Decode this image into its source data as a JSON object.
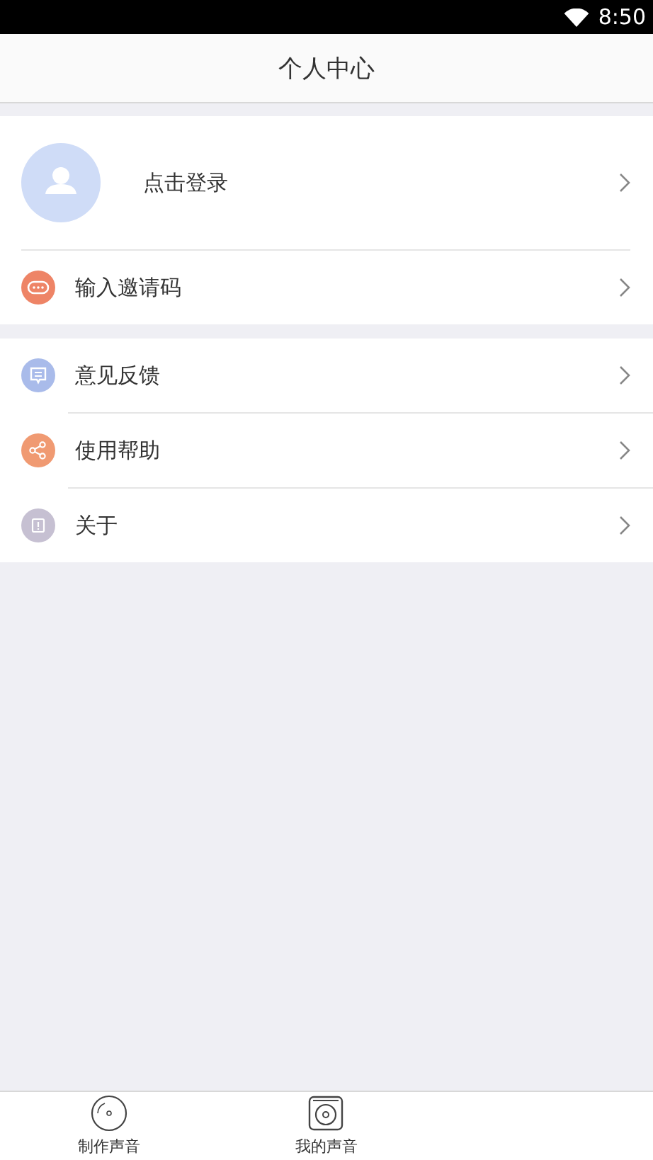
{
  "status_bar": {
    "time": "8:50"
  },
  "header": {
    "title": "个人中心"
  },
  "login": {
    "label": "点击登录"
  },
  "groups": [
    [
      {
        "label": "输入邀请码",
        "kind": "dots",
        "color": "#ee8466"
      }
    ],
    [
      {
        "label": "意见反馈",
        "kind": "message",
        "color": "#a9bbea"
      },
      {
        "label": "使用帮助",
        "kind": "share",
        "color": "#f09a72"
      },
      {
        "label": "关于",
        "kind": "info",
        "color": "#c6c0d2"
      }
    ]
  ],
  "tabs": [
    {
      "label": "制作声音",
      "kind": "disc"
    },
    {
      "label": "我的声音",
      "kind": "record"
    }
  ]
}
